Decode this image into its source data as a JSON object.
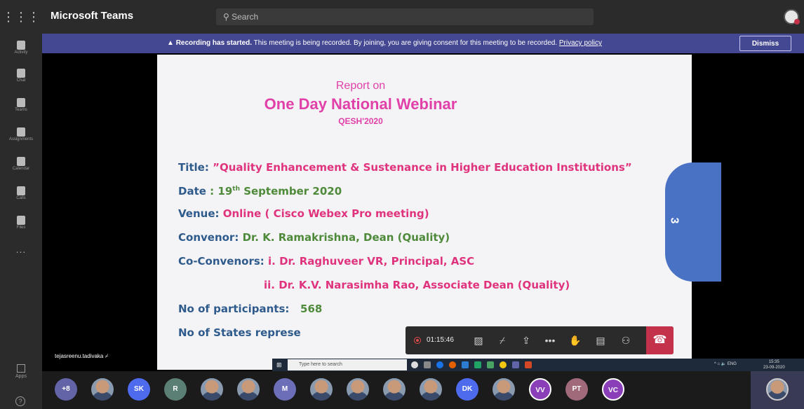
{
  "app": {
    "title": "Microsoft Teams"
  },
  "search": {
    "placeholder": "Search"
  },
  "rail": {
    "items": [
      {
        "label": "Activity"
      },
      {
        "label": "Chat"
      },
      {
        "label": "Teams"
      },
      {
        "label": "Assignments"
      },
      {
        "label": "Calendar"
      },
      {
        "label": "Calls"
      },
      {
        "label": "Files"
      }
    ],
    "more": "...",
    "apps_label": "Apps",
    "help_label": "?"
  },
  "banner": {
    "bold": "Recording has started.",
    "text": " This meeting is being recorded. By joining, you are giving consent for this meeting to be recorded. ",
    "link": "Privacy policy",
    "dismiss": "Dismiss"
  },
  "slide": {
    "report": "Report on",
    "webinar": "One Day National Webinar",
    "qesh": "QESH'2020",
    "title_label": "Title:",
    "title_value": "”Quality Enhancement & Sustenance in Higher Education Institutions”",
    "date_label": "Date",
    "date_value": ": 19",
    "date_sup": "th",
    "date_rest": " September 2020",
    "venue_label": "Venue:",
    "venue_value": "Online ( Cisco Webex Pro meeting)",
    "convenor_label": "Convenor:",
    "convenor_value": "Dr. K. Ramakrishna, Dean (Quality)",
    "coconvenor_label": "Co-Convenors:",
    "coconvenor_1": "i.  Dr. Raghuveer VR, Principal, ASC",
    "coconvenor_2": "ii. Dr. K.V. Narasimha Rao, Associate Dean (Quality)",
    "participants_label": "No of participants:",
    "participants_value": "568",
    "states_label": "No of States represe",
    "page_number": "3"
  },
  "call": {
    "timer": "01:15:46",
    "participant_name": "tejasreenu.tadivaka"
  },
  "presenter_taskbar": {
    "search_placeholder": "Type here to search",
    "tray": "ENG",
    "time": "15:35",
    "date": "23-09-2020"
  },
  "roster": [
    {
      "initials": "+8",
      "color": "#6264a7"
    },
    {
      "initials": "",
      "color": "",
      "photo": true
    },
    {
      "initials": "SK",
      "color": "#4f6bed"
    },
    {
      "initials": "R",
      "color": "#5b7f74"
    },
    {
      "initials": "",
      "color": "",
      "photo": true
    },
    {
      "initials": "",
      "color": "",
      "photo": true
    },
    {
      "initials": "M",
      "color": "#6c6fb8"
    },
    {
      "initials": "",
      "color": "",
      "photo": true
    },
    {
      "initials": "",
      "color": "",
      "photo": true
    },
    {
      "initials": "",
      "color": "",
      "photo": true
    },
    {
      "initials": "",
      "color": "",
      "photo": true
    },
    {
      "initials": "DK",
      "color": "#4f6bed"
    },
    {
      "initials": "",
      "color": "",
      "photo": true
    },
    {
      "initials": "VV",
      "color": "#8a3fb8"
    },
    {
      "initials": "PT",
      "color": "#a06a7a"
    },
    {
      "initials": "VC",
      "color": "#8a3fb8"
    }
  ],
  "colors": {
    "brand": "#444791",
    "hangup": "#c4314b",
    "slide_pink": "#e0337d",
    "slide_blue": "#2f5a8c",
    "slide_green": "#4e8a3a"
  }
}
